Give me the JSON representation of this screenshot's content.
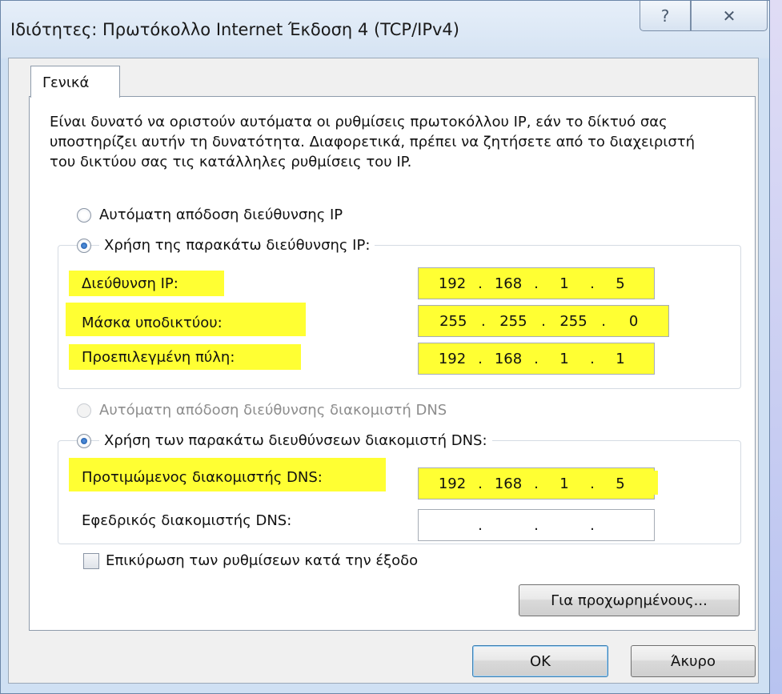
{
  "window": {
    "title": "Ιδιότητες: Πρωτόκολλο Internet Έκδοση 4 (TCP/IPv4)",
    "help_glyph": "?",
    "close_glyph": "✕"
  },
  "tab": {
    "label": "Γενικά"
  },
  "description": "Είναι δυνατό να οριστούν αυτόματα οι ρυθμίσεις πρωτοκόλλου IP, εάν το δίκτυό σας υποστηρίζει αυτήν τη δυνατότητα. Διαφορετικά, πρέπει να ζητήσετε από το διαχειριστή του δικτύου σας τις κατάλληλες ρυθμίσεις του IP.",
  "ip_mode": {
    "auto_label": "Αυτόματη απόδοση διεύθυνσης IP",
    "manual_label": "Χρήση της παρακάτω διεύθυνσης IP:",
    "selected": "manual"
  },
  "ip_fields": {
    "address": {
      "label": "Διεύθυνση IP:",
      "octets": [
        "192",
        "168",
        "1",
        "5"
      ]
    },
    "subnet": {
      "label": "Μάσκα υποδικτύου:",
      "octets": [
        "255",
        "255",
        "255",
        "0"
      ]
    },
    "gateway": {
      "label": "Προεπιλεγμένη πύλη:",
      "octets": [
        "192",
        "168",
        "1",
        "1"
      ]
    }
  },
  "dns_mode": {
    "auto_label": "Αυτόματη απόδοση διεύθυνσης διακομιστή DNS",
    "manual_label": "Χρήση των παρακάτω διευθύνσεων διακομιστή DNS:",
    "selected": "manual"
  },
  "dns_fields": {
    "preferred": {
      "label": "Προτιμώμενος διακομιστής DNS:",
      "octets": [
        "192",
        "168",
        "1",
        "5"
      ]
    },
    "alternate": {
      "label": "Εφεδρικός διακομιστής DNS:",
      "octets": [
        "",
        "",
        "",
        ""
      ]
    }
  },
  "validate_on_exit": {
    "label": "Επικύρωση των ρυθμίσεων κατά την έξοδο",
    "checked": false
  },
  "buttons": {
    "advanced": "Για προχωρημένους...",
    "ok": "OK",
    "cancel": "Άκυρο"
  },
  "colors": {
    "highlight": "#ffff33",
    "titlebar": "#d5e3f3",
    "window_frame": "#cfe0f3"
  }
}
